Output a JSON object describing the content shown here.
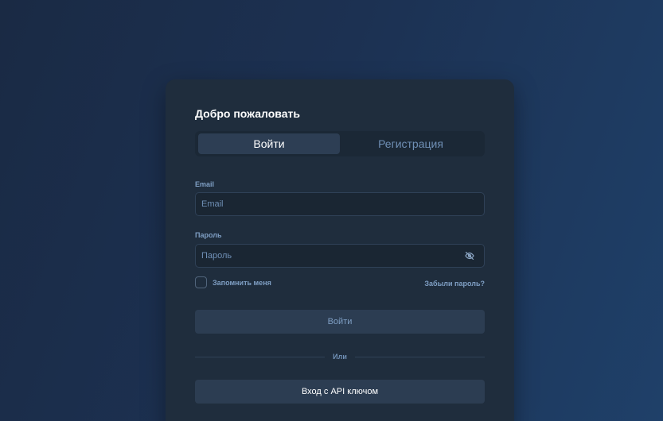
{
  "login_card": {
    "title": "Добро пожаловать",
    "tabs": [
      {
        "label": "Войти",
        "active": true
      },
      {
        "label": "Регистрация",
        "active": false
      }
    ],
    "email": {
      "label": "Email",
      "placeholder": "Email",
      "value": ""
    },
    "password": {
      "label": "Пароль",
      "placeholder": "Пароль",
      "value": "",
      "toggle_icon": "eye-off-icon"
    },
    "remember_me": {
      "label": "Запомнить меня",
      "checked": false
    },
    "forgot_password": "Забыли пароль?",
    "submit_label": "Войти",
    "divider_text": "Или",
    "api_key_label": "Вход с API ключом"
  },
  "colors": {
    "background_start": "#1a2a44",
    "background_end": "#1f4069",
    "card": "#1f2d3d",
    "accent_text": "#7f9fc4",
    "button": "#2c3d52"
  }
}
